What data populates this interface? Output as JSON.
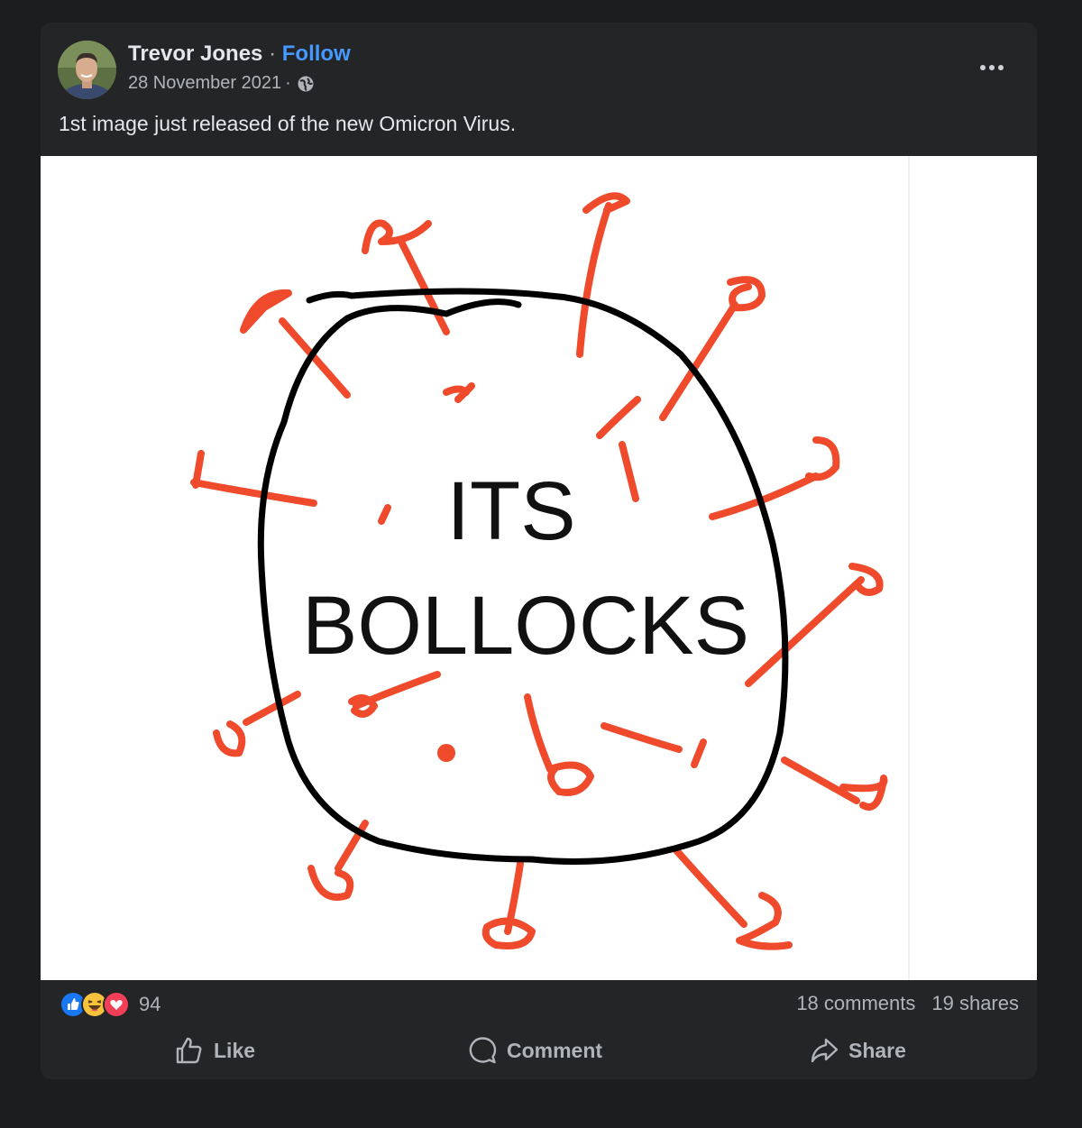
{
  "post": {
    "author": "Trevor Jones",
    "separator": "·",
    "follow_label": "Follow",
    "date": "28 November 2021",
    "meta_separator": "·",
    "audience_icon": "globe-icon",
    "text": "1st image just released of the new Omicron Virus.",
    "image": {
      "line1": "ITS",
      "line2": "BOLLOCKS",
      "stroke_color": "#000000",
      "spike_color": "#f04a2c"
    }
  },
  "engagement": {
    "reaction_icons": [
      "like-reaction-icon",
      "haha-reaction-icon",
      "love-reaction-icon"
    ],
    "reaction_count": "94",
    "comments": "18 comments",
    "shares": "19 shares"
  },
  "actions": {
    "like": "Like",
    "comment": "Comment",
    "share": "Share"
  },
  "colors": {
    "page_bg": "#1c1d1f",
    "card_bg": "#242526",
    "text_primary": "#e4e6eb",
    "text_secondary": "#b0b3b8",
    "link": "#4599ff"
  }
}
